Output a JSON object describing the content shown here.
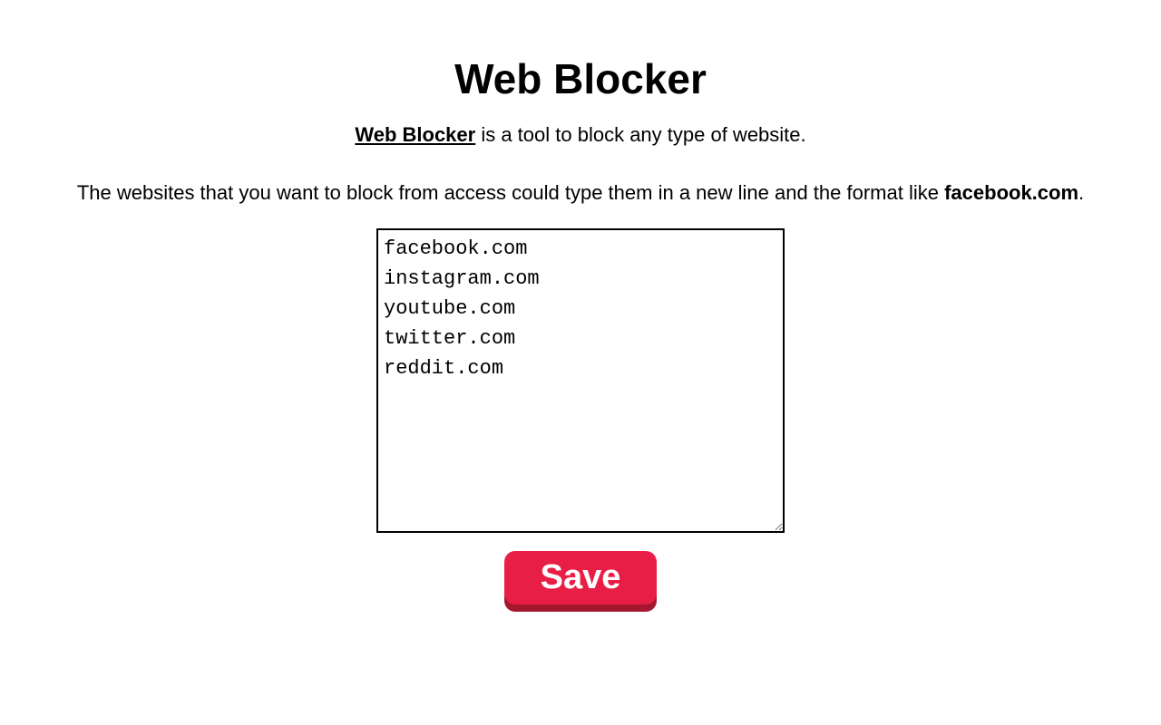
{
  "header": {
    "title": "Web Blocker"
  },
  "description": {
    "strong": "Web Blocker",
    "rest": " is a tool to block any type of website."
  },
  "instruction": {
    "prefix": "The websites that you want to block from access could type them in a new line and the format like ",
    "example": "facebook.com",
    "suffix": "."
  },
  "blocked_sites": {
    "value": "facebook.com\ninstagram.com\nyoutube.com\ntwitter.com\nreddit.com"
  },
  "buttons": {
    "save_label": "Save"
  },
  "colors": {
    "accent": "#e91e46",
    "accent_shadow": "#a5162f"
  }
}
